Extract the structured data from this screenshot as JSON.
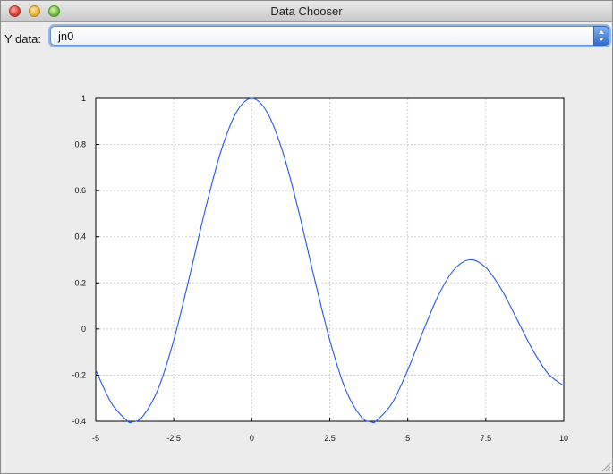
{
  "window": {
    "title": "Data Chooser"
  },
  "controls": {
    "y_label": "Y data:",
    "y_selected": "jn0"
  },
  "chart_data": {
    "type": "line",
    "title": "",
    "xlabel": "",
    "ylabel": "",
    "xlim": [
      -5,
      10
    ],
    "ylim": [
      -0.4,
      1
    ],
    "grid": true,
    "x_ticks": [
      -5,
      -2.5,
      0,
      2.5,
      5,
      7.5,
      10
    ],
    "x_tick_labels": [
      "-5",
      "-2.5",
      "0",
      "2.5",
      "5",
      "7.5",
      "10"
    ],
    "y_ticks": [
      -0.4,
      -0.2,
      0,
      0.2,
      0.4,
      0.6,
      0.8,
      1
    ],
    "y_tick_labels": [
      "-0.4",
      "-0.2",
      "0",
      "0.2",
      "0.4",
      "0.6",
      "0.8",
      "1"
    ],
    "series": [
      {
        "color": "#2255ee",
        "x": [
          -5,
          -4.5,
          -4,
          -3.83,
          -3.5,
          -3,
          -2.5,
          -2,
          -1.5,
          -1,
          -0.5,
          0,
          0.5,
          1,
          1.5,
          2,
          2.5,
          3,
          3.5,
          3.83,
          4,
          4.5,
          5,
          5.5,
          6,
          6.5,
          7,
          7.5,
          8,
          8.5,
          9,
          9.5,
          10
        ],
        "y": [
          -0.178,
          -0.321,
          -0.397,
          -0.403,
          -0.38,
          -0.26,
          -0.048,
          0.224,
          0.512,
          0.765,
          0.938,
          1.0,
          0.938,
          0.765,
          0.512,
          0.224,
          -0.048,
          -0.26,
          -0.38,
          -0.403,
          -0.397,
          -0.321,
          -0.178,
          -0.007,
          0.151,
          0.26,
          0.3,
          0.266,
          0.172,
          0.042,
          -0.09,
          -0.194,
          -0.246
        ]
      }
    ]
  }
}
